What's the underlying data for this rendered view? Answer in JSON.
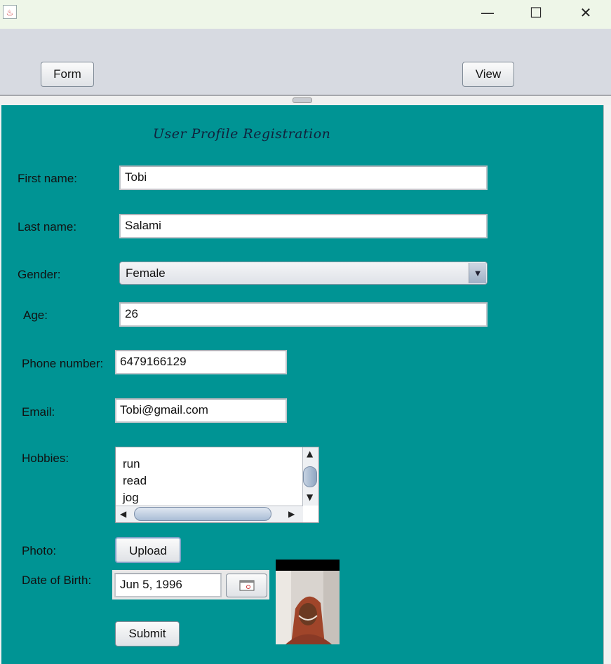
{
  "window": {
    "icon": "java-cup-icon",
    "minimize": "—",
    "maximize": "☐",
    "close": "✕"
  },
  "toolbar": {
    "form_label": "Form",
    "view_label": "View"
  },
  "form": {
    "title": "User Profile Registration",
    "first_name": {
      "label": "First name:",
      "value": "Tobi"
    },
    "last_name": {
      "label": "Last name:",
      "value": "Salami"
    },
    "gender": {
      "label": "Gender:",
      "value": "Female"
    },
    "age": {
      "label": "Age:",
      "value": "26"
    },
    "phone": {
      "label": "Phone number:",
      "value": "6479166129"
    },
    "email": {
      "label": "Email:",
      "value": "Tobi@gmail.com"
    },
    "hobbies": {
      "label": "Hobbies:",
      "items": [
        "run",
        "read",
        "jog"
      ]
    },
    "photo": {
      "label": "Photo:",
      "upload_label": "Upload"
    },
    "dob": {
      "label": "Date of Birth:",
      "value": "Jun 5, 1996"
    },
    "submit_label": "Submit"
  },
  "colors": {
    "panel_bg": "#009494",
    "titlebar_bg": "#eef6e8",
    "toolbar_bg": "#d7dae1"
  }
}
